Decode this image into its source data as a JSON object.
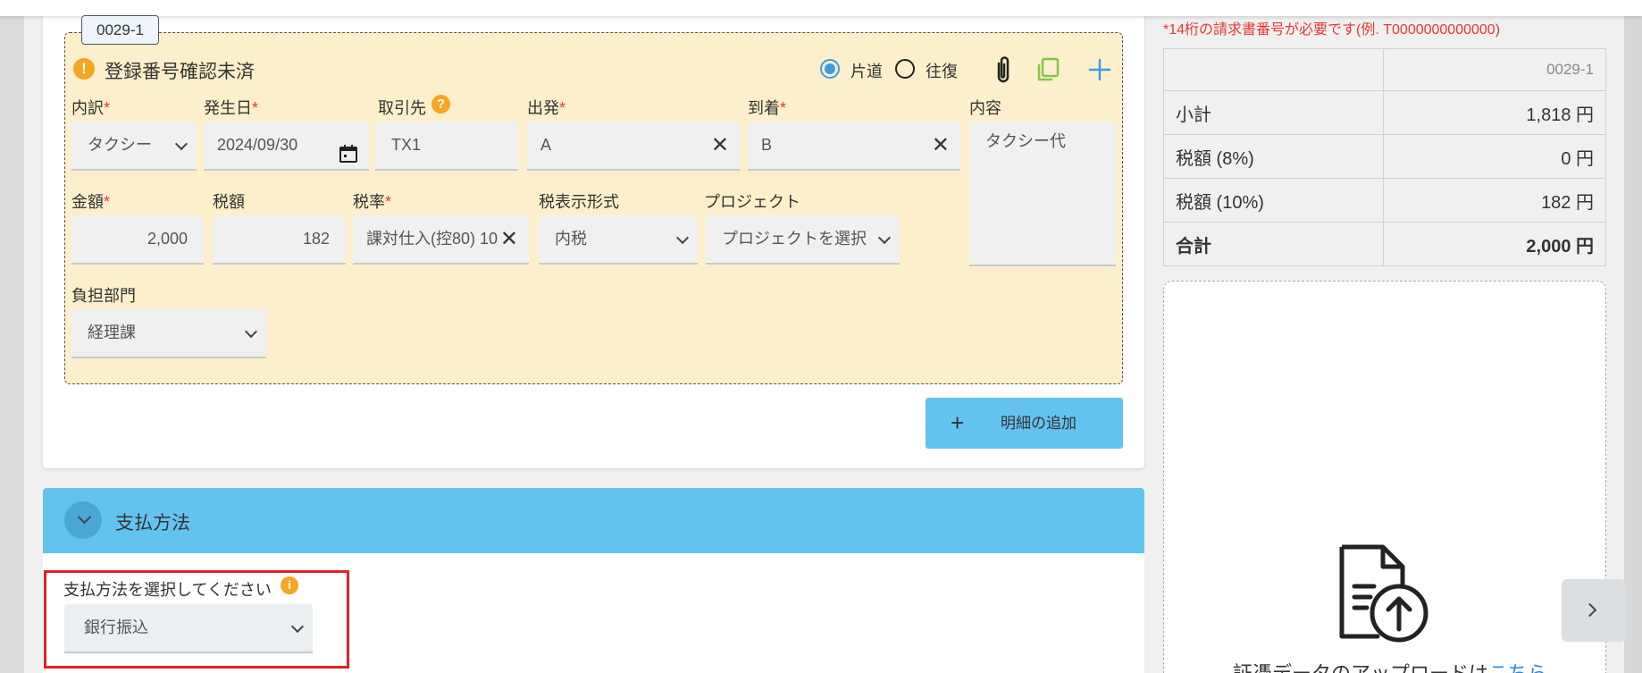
{
  "detail": {
    "id_tag": "0029-1",
    "status": "登録番号確認未済",
    "trip": {
      "one_way": "片道",
      "round_trip": "往復",
      "selected": "one_way"
    },
    "labels": {
      "category": "内訳",
      "date": "発生日",
      "vendor": "取引先",
      "departure": "出発",
      "arrival": "到着",
      "content": "内容",
      "amount": "金額",
      "tax": "税額",
      "tax_rate": "税率",
      "tax_format": "税表示形式",
      "project": "プロジェクト",
      "department": "負担部門",
      "required_mark": "*"
    },
    "values": {
      "category": "タクシー",
      "date": "2024/09/30",
      "vendor": "TX1",
      "departure": "A",
      "arrival": "B",
      "content": "タクシー代",
      "amount": "2,000",
      "tax": "182",
      "tax_rate": "課対仕入(控80) 10",
      "tax_format": "内税",
      "project": "プロジェクトを選択",
      "department": "経理課"
    }
  },
  "add_detail_button": {
    "icon": "+",
    "label": "明細の追加"
  },
  "payment": {
    "title": "支払方法",
    "prompt": "支払方法を選択してください",
    "selected": "銀行振込"
  },
  "summary": {
    "notice": "*14桁の請求書番号が必要です(例. T0000000000000)",
    "header": "0029-1",
    "rows": [
      {
        "label": "小計",
        "value": "1,818 円"
      },
      {
        "label": "税額 (8%)",
        "value": "0 円"
      },
      {
        "label": "税額 (10%)",
        "value": "182 円"
      }
    ],
    "total": {
      "label": "合計",
      "value": "2,000 円"
    }
  },
  "upload": {
    "text": "証憑データのアップロードは",
    "link": "こちら"
  },
  "colors": {
    "accent": "#64c2ef",
    "warning": "#f5a623",
    "required": "#e53935",
    "detail_bg": "#fdefcb",
    "highlight": "#e0202c"
  }
}
